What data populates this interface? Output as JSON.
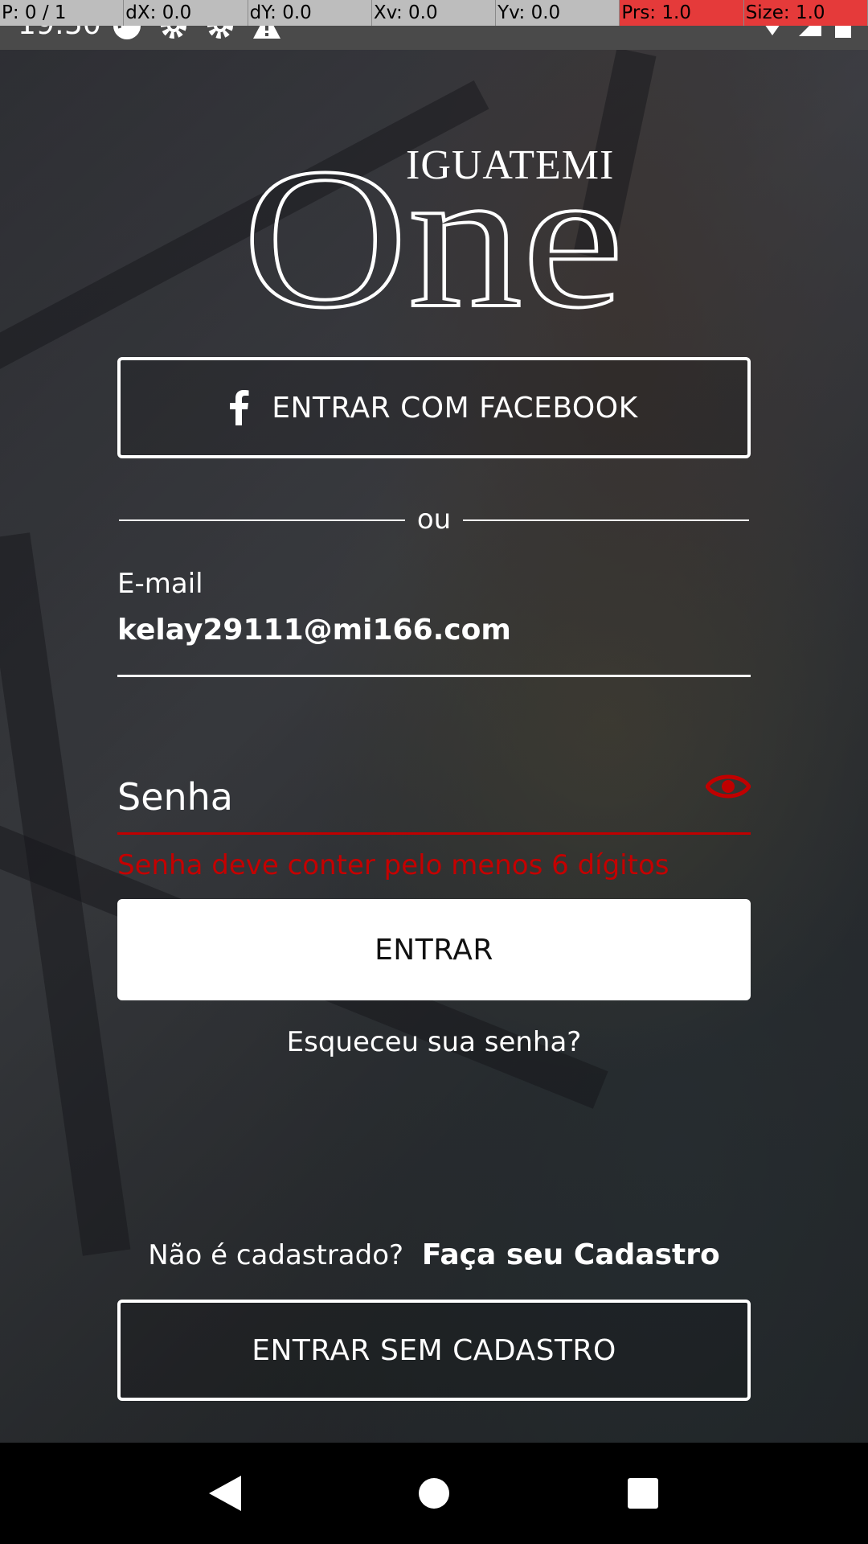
{
  "debug": {
    "p": "P: 0 / 1",
    "dx": "dX: 0.0",
    "dy": "dY: 0.0",
    "xv": "Xv: 0.0",
    "yv": "Yv: 0.0",
    "prs": "Prs: 1.0",
    "size": "Size: 1.0"
  },
  "status": {
    "time": "19:50"
  },
  "logo": {
    "brand_top": "IGUATEMI",
    "brand_main": "One"
  },
  "facebook_button": {
    "label": "ENTRAR COM FACEBOOK",
    "icon": "facebook-icon"
  },
  "divider": {
    "text": "ou"
  },
  "email": {
    "label": "E-mail",
    "value": "kelay29111@mi166.com"
  },
  "password": {
    "placeholder": "Senha",
    "error": "Senha deve conter pelo menos 6 dígitos",
    "icon": "eye-icon",
    "error_color": "#c40000"
  },
  "login_button": {
    "label": "ENTRAR"
  },
  "forgot_link": {
    "label": "Esqueceu sua senha?"
  },
  "register": {
    "question": "Não é cadastrado?",
    "link": "Faça seu Cadastro"
  },
  "guest_button": {
    "label": "ENTRAR SEM CADASTRO"
  },
  "nav": {
    "back": "back-icon",
    "home": "home-icon",
    "recents": "recents-icon"
  }
}
